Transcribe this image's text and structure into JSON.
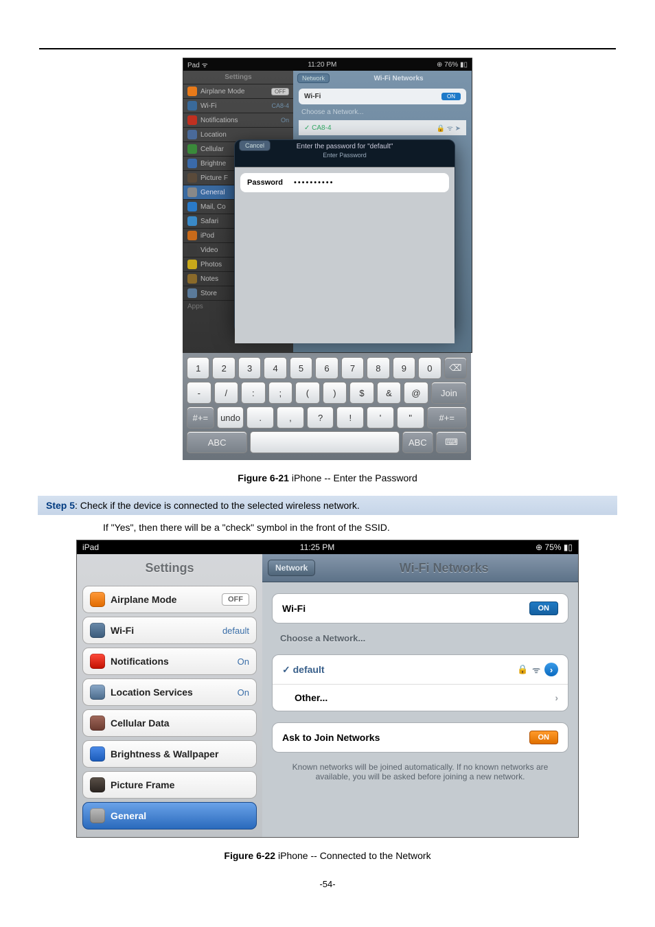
{
  "page_number_label": "-54-",
  "fig1": {
    "statusbar": {
      "left": "Pad ᯤ",
      "center": "11:20 PM",
      "right": "⊕ 76% ▮▯"
    },
    "settings_title": "Settings",
    "rows": {
      "airplane": {
        "label": "Airplane Mode",
        "value": "OFF"
      },
      "wifi": {
        "label": "Wi-Fi",
        "value": "CA8-4"
      },
      "notifications": {
        "label": "Notifications",
        "value": "On"
      },
      "location": {
        "label": "Location"
      },
      "cellular": {
        "label": "Cellular"
      },
      "brightness": {
        "label": "Brightne"
      },
      "picture": {
        "label": "Picture F"
      },
      "general": {
        "label": "General"
      },
      "mail": {
        "label": "Mail, Co"
      },
      "safari": {
        "label": "Safari"
      },
      "ipod": {
        "label": "iPod"
      },
      "video": {
        "label": "Video"
      },
      "photos": {
        "label": "Photos"
      },
      "notes": {
        "label": "Notes"
      },
      "store": {
        "label": "Store"
      },
      "apps": {
        "label": "Apps"
      }
    },
    "detail": {
      "back": "Network",
      "title": "Wi-Fi Networks",
      "wifi_row": {
        "label": "Wi-Fi",
        "value": "ON"
      },
      "choose": "Choose a Network...",
      "net1": "✓ CA8-4"
    },
    "modal": {
      "cancel": "Cancel",
      "line1": "Enter the password for \"default\"",
      "line2": "Enter Password",
      "pw_label": "Password",
      "pw_dots": "••••••••••"
    },
    "keyboard": {
      "row1": [
        "1",
        "2",
        "3",
        "4",
        "5",
        "6",
        "7",
        "8",
        "9",
        "0",
        "⌫"
      ],
      "row2": [
        "-",
        "/",
        ":",
        ";",
        "(",
        ")",
        "$",
        "&",
        "@",
        "Join"
      ],
      "row3": [
        "#+=",
        "undo",
        ".",
        ",",
        "?",
        "!",
        "'",
        "\"",
        "#+="
      ],
      "row4": [
        "ABC",
        "",
        "ABC",
        "⌨"
      ]
    },
    "caption_bold": "Figure 6-21",
    "caption_rest": " iPhone -- Enter the Password"
  },
  "step5": {
    "label": "Step 5",
    "text": ": Check if the device is connected to the selected wireless network.",
    "sub": "If \"Yes\", then there will be a \"check\" symbol in the front of the SSID."
  },
  "fig2": {
    "statusbar": {
      "left": "iPad",
      "center": "11:25 PM",
      "right": "⊕ 75% ▮▯"
    },
    "settings_title": "Settings",
    "rows": {
      "airplane": {
        "label": "Airplane Mode",
        "value": "OFF"
      },
      "wifi": {
        "label": "Wi-Fi",
        "value": "default"
      },
      "notifications": {
        "label": "Notifications",
        "value": "On"
      },
      "location": {
        "label": "Location Services",
        "value": "On"
      },
      "cellular": {
        "label": "Cellular Data"
      },
      "brightness": {
        "label": "Brightness & Wallpaper"
      },
      "picture": {
        "label": "Picture Frame"
      },
      "general": {
        "label": "General"
      }
    },
    "detail": {
      "back": "Network",
      "title": "Wi-Fi Networks",
      "wifi_row": {
        "label": "Wi-Fi",
        "value": "ON"
      },
      "choose": "Choose a Network...",
      "net_default": "✓ default",
      "other": "Other...",
      "ask": {
        "label": "Ask to Join Networks",
        "value": "ON"
      },
      "note": "Known networks will be joined automatically. If no known networks are available, you will be asked before joining a new network."
    },
    "caption_bold": "Figure 6-22",
    "caption_rest": " iPhone -- Connected to the Network"
  }
}
